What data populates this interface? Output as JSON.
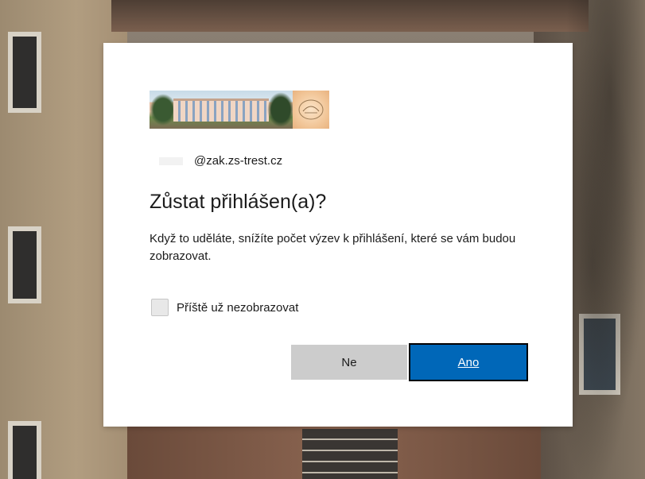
{
  "dialog": {
    "email_suffix": "@zak.zs-trest.cz",
    "title": "Zůstat přihlášen(a)?",
    "description": "Když to uděláte, snížíte počet výzev k přihlášení, které se vám budou zobrazovat.",
    "checkbox_label": "Příště už nezobrazovat",
    "checkbox_checked": false,
    "no_label": "Ne",
    "yes_label": "Ano"
  },
  "colors": {
    "primary_button": "#0067b8",
    "secondary_button": "#cccccc",
    "text": "#1b1b1b"
  },
  "icons": {
    "logo": "school-building-logo",
    "seal": "school-seal-icon"
  }
}
